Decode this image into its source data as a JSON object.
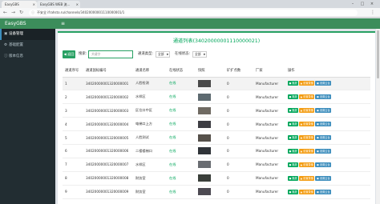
{
  "browser": {
    "tabs": [
      {
        "label": "EasyGBS"
      },
      {
        "label": "EasyGBS WEB 流..."
      }
    ],
    "url_security": "不安全",
    "url": "ifrahsto.ru/channels/34020000001110000001/1",
    "menu_dots": "⋮"
  },
  "app": {
    "brand": "EasyGBS",
    "menu_icon": "≡",
    "sidebar": [
      {
        "label": "设备管理",
        "icon": "video-icon"
      },
      {
        "label": "基础配置",
        "icon": "gear-icon"
      },
      {
        "label": "版本信息",
        "icon": "info-icon"
      }
    ]
  },
  "page": {
    "title": "通道列表(34020000001110000021)",
    "back_label": "◀ 返回",
    "search_label": "搜索:",
    "search_placeholder": "关键字",
    "type_label": "通道类型:",
    "type_value": "全部",
    "status_label": "在线状态:",
    "status_value": "全部"
  },
  "table": {
    "columns": [
      "通道序号",
      "通道国标编号",
      "通道名称",
      "在线状态",
      "快照",
      "矿扩点数",
      "厂家",
      "操作"
    ],
    "actions": [
      "● 播放",
      "▲ 设置录像",
      "▣ 设置云台"
    ],
    "rows": [
      {
        "idx": "1",
        "code": "34020000001320000001",
        "name": "人脸检测",
        "status": "在线",
        "points": "0",
        "vendor": "Manufacturer"
      },
      {
        "idx": "2",
        "code": "34020000001320000002",
        "name": "水样区",
        "status": "在线",
        "points": "0",
        "vendor": "Manufacturer"
      },
      {
        "idx": "3",
        "code": "34020000001320000003",
        "name": "区位口中区",
        "status": "在线",
        "points": "0",
        "vendor": "Manufacturer"
      },
      {
        "idx": "4",
        "code": "34020000001320000004",
        "name": "电梯口上方",
        "status": "在线",
        "points": "0",
        "vendor": "Manufacturer"
      },
      {
        "idx": "5",
        "code": "34020000001320000005",
        "name": "人脸测试",
        "status": "在线",
        "points": "0",
        "vendor": "Manufacturer"
      },
      {
        "idx": "6",
        "code": "34020000001320000006",
        "name": "二楼楼梯口",
        "status": "在线",
        "points": "0",
        "vendor": "Manufacturer"
      },
      {
        "idx": "7",
        "code": "34020000001320000007",
        "name": "水样区",
        "status": "在线",
        "points": "0",
        "vendor": "Manufacturer"
      },
      {
        "idx": "8",
        "code": "34020000001320000008",
        "name": "财务室",
        "status": "在线",
        "points": "0",
        "vendor": "Manufacturer"
      },
      {
        "idx": "9",
        "code": "34020000001320000009",
        "name": "财务室",
        "status": "在线",
        "points": "0",
        "vendor": "Manufacturer"
      }
    ]
  },
  "colors": {
    "brand_green": "#3c8d5b",
    "accent_green": "#00a65a",
    "sidebar_bg": "#222d32"
  }
}
